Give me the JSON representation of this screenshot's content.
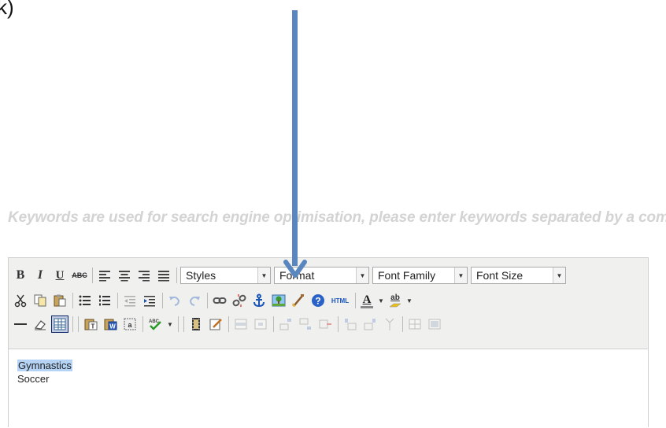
{
  "fragment": "k)",
  "keywords_hint": "Keywords are used for search engine optimisation, please enter keywords separated by a comma.",
  "colors": {
    "arrow": "#5a86c0",
    "selection": "#b5d3f5",
    "toolbar_bg": "#f0f0ee"
  },
  "toolbar": {
    "row1": {
      "bold": "B",
      "italic": "I",
      "underline": "U",
      "strikethrough": "ABC",
      "icons": [
        "align-left-icon",
        "align-center-icon",
        "align-right-icon",
        "align-justify-icon"
      ],
      "selects": {
        "styles": "Styles",
        "format": "Format",
        "font_family": "Font Family",
        "font_size": "Font Size"
      }
    },
    "row2": {
      "icons": [
        "cut-icon",
        "copy-icon",
        "paste-icon",
        "bullet-list-icon",
        "numbered-list-icon",
        "outdent-icon",
        "indent-icon",
        "undo-icon",
        "redo-icon",
        "link-icon",
        "unlink-icon",
        "anchor-icon",
        "image-icon",
        "cleanup-icon",
        "help-icon",
        "html-source-icon",
        "text-color-icon",
        "highlight-color-icon"
      ],
      "html_label": "HTML",
      "text_color_label": "A",
      "highlight_label": "ab"
    },
    "row3": {
      "icons": [
        "horizontal-rule-icon",
        "remove-format-icon",
        "visual-aid-icon",
        "paste-text-icon",
        "paste-word-icon",
        "select-all-icon",
        "spellcheck-icon",
        "media-icon",
        "edit-icon",
        "table-row-props-icon",
        "table-cell-props-icon",
        "insert-row-before-icon",
        "insert-row-after-icon",
        "delete-row-icon",
        "insert-col-before-icon",
        "insert-col-after-icon",
        "delete-col-icon",
        "split-cells-icon",
        "merge-cells-icon"
      ]
    }
  },
  "content": {
    "lines": [
      "Gymnastics",
      "Soccer"
    ]
  }
}
